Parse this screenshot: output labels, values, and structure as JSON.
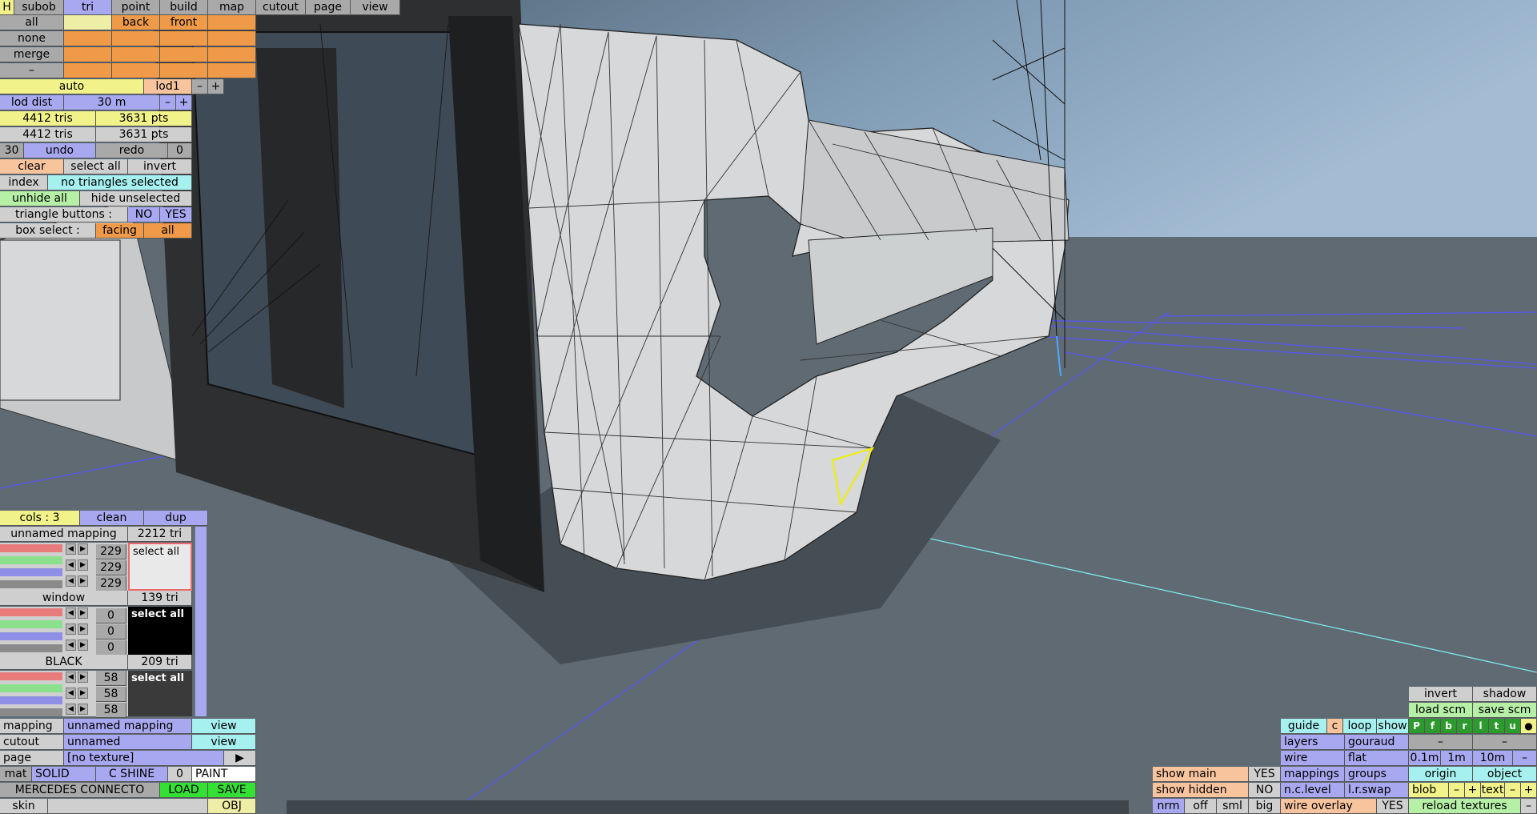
{
  "top_menu": {
    "h": "H",
    "items": [
      "subob",
      "tri",
      "point",
      "build",
      "map",
      "cutout",
      "page",
      "view"
    ]
  },
  "tri_menu": {
    "all": "all",
    "back": "back",
    "front": "front",
    "none": "none",
    "merge": "merge",
    "dash": "–"
  },
  "lod": {
    "auto": "auto",
    "lod1": "lod1",
    "minus": "–",
    "plus": "+",
    "dist_label": "lod dist",
    "dist_value": "30 m"
  },
  "stats": {
    "tris1": "4412 tris",
    "pts1": "3631 pts",
    "tris2": "4412 tris",
    "pts2": "3631 pts"
  },
  "undo": {
    "count": "30",
    "undo": "undo",
    "redo": "redo",
    "redo_count": "0"
  },
  "sel": {
    "clear": "clear",
    "select_all": "select all",
    "invert": "invert",
    "index": "index",
    "status": "no triangles selected",
    "unhide_all": "unhide all",
    "hide_unselected": "hide unselected",
    "tri_buttons_label": "triangle buttons :",
    "no": "NO",
    "yes": "YES",
    "box_select_label": "box select :",
    "facing": "facing",
    "all": "all"
  },
  "cols": {
    "label": "cols : 3",
    "clean": "clean",
    "dup": "dup"
  },
  "materials": [
    {
      "name": "unnamed mapping",
      "tri": "2212 tri",
      "values": [
        "229",
        "229",
        "229"
      ],
      "select": "select all",
      "swatch": "#e9e9e9"
    },
    {
      "name": "window",
      "tri": "139 tri",
      "values": [
        "0",
        "0",
        "0"
      ],
      "select": "select all",
      "swatch": "#000000"
    },
    {
      "name": "BLACK",
      "tri": "209 tri",
      "values": [
        "58",
        "58",
        "58"
      ],
      "select": "select all",
      "swatch": "#3a3a3a"
    }
  ],
  "props": {
    "mapping_label": "mapping",
    "mapping_value": "unnamed mapping",
    "view1": "view",
    "cutout_label": "cutout",
    "cutout_value": "unnamed",
    "view2": "view",
    "page_label": "page",
    "page_value": "[no texture]",
    "page_arrow": "▶",
    "mat": "mat",
    "solid": "SOLID",
    "c_shine": "C SHINE",
    "shine_value": "0",
    "paint": "PAINT",
    "model_name": "MERCEDES CONNECTO",
    "load": "LOAD",
    "save": "SAVE",
    "skin": "skin",
    "obj": "OBJ"
  },
  "br": {
    "invert": "invert",
    "shadow": "shadow",
    "load_scm": "load scm",
    "save_scm": "save scm",
    "guide": "guide",
    "c": "c",
    "loop": "loop",
    "show": "show",
    "pf": [
      "P",
      "f",
      "b",
      "r",
      "l",
      "t",
      "u"
    ],
    "dot": "●",
    "layers": "layers",
    "gouraud": "gouraud",
    "dash1": "–",
    "dash2": "–",
    "wire": "wire",
    "flat": "flat",
    "d01": "0.1m",
    "d1": "1m",
    "d10": "10m",
    "dminus": "–",
    "show_main": "show main",
    "yes1": "YES",
    "mappings": "mappings",
    "groups": "groups",
    "origin": "origin",
    "object": "object",
    "show_hidden": "show hidden",
    "no1": "NO",
    "nclevel": "n.c.level",
    "lrswap": "l.r.swap",
    "blob": "blob",
    "bminus": "–",
    "bplus": "+",
    "text": "text",
    "tminus": "–",
    "tplus": "+",
    "nrm": "nrm",
    "off": "off",
    "sml": "sml",
    "big": "big",
    "wire_overlay": "wire overlay",
    "yes2": "YES",
    "reload": "reload textures",
    "rminus": "–"
  },
  "colors": {
    "sky": "#7f9ab3",
    "ground": "#5f6a73",
    "mesh": "#d6d8d9",
    "grid": "#5b5bff"
  }
}
